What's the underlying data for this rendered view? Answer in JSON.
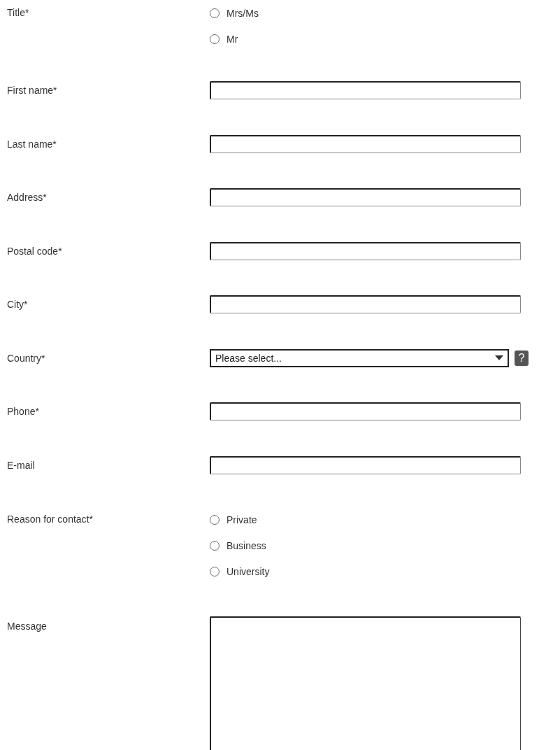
{
  "fields": [
    {
      "kind": "radio_group",
      "label": "Title*",
      "options": [
        {
          "label": "Mrs/Ms",
          "selected": false
        },
        {
          "label": "Mr",
          "selected": false
        }
      ]
    },
    {
      "kind": "text",
      "label": "First name*"
    },
    {
      "kind": "text",
      "label": "Last name*"
    },
    {
      "kind": "text",
      "label": "Address*"
    },
    {
      "kind": "text",
      "label": "Postal code*"
    },
    {
      "kind": "text",
      "label": "City*"
    },
    {
      "kind": "select",
      "label": "Country*",
      "value": "Please select...",
      "help": "?"
    },
    {
      "kind": "text",
      "label": "Phone*"
    },
    {
      "kind": "text",
      "label": "E-mail"
    },
    {
      "kind": "radio_group",
      "label": "Reason for contact*",
      "options": [
        {
          "label": "Private",
          "selected": false
        },
        {
          "label": "Business",
          "selected": false
        },
        {
          "label": "University",
          "selected": false
        }
      ]
    },
    {
      "kind": "textarea",
      "label": "Message"
    }
  ]
}
